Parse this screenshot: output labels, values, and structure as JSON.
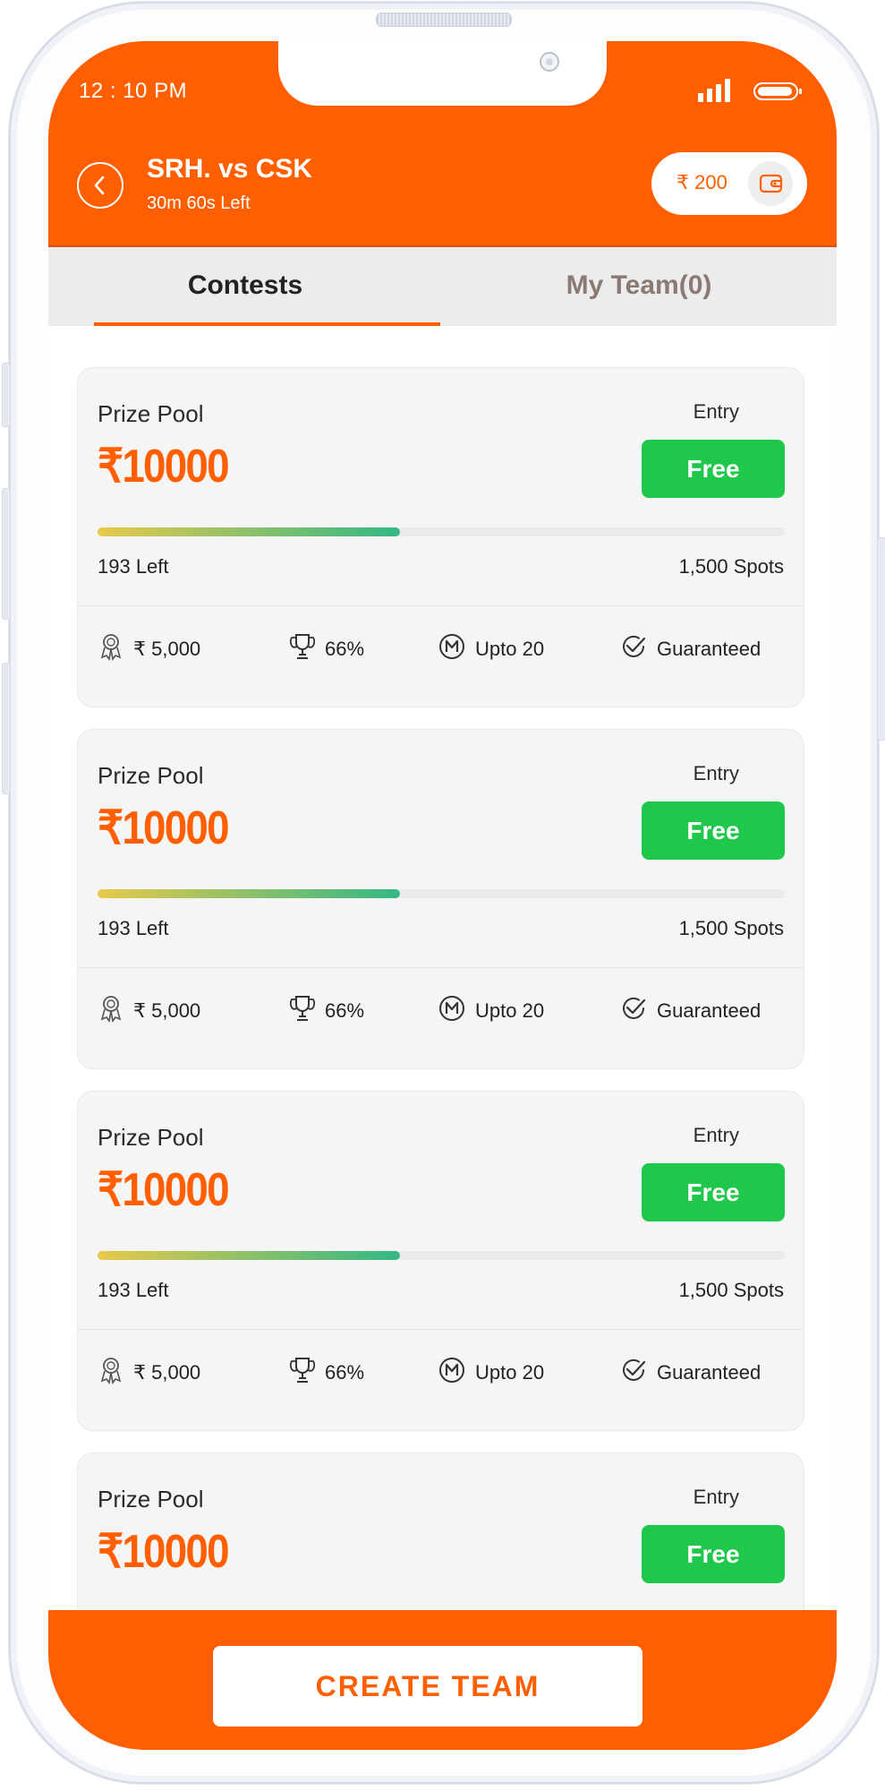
{
  "status_bar": {
    "time": "12 : 10 PM"
  },
  "header": {
    "title": "SRH. vs CSK",
    "time_left": "30m 60s Left",
    "wallet_amount": "₹ 200"
  },
  "tabs": [
    {
      "label": "Contests",
      "active": true
    },
    {
      "label": "My Team(0)",
      "active": false
    }
  ],
  "contests": [
    {
      "prize_label": "Prize Pool",
      "prize_amount": "₹10000",
      "entry_label": "Entry",
      "entry_value": "Free",
      "spots_left": "193 Left",
      "total_spots": "1,500 Spots",
      "fill_fraction": 0.44,
      "first_prize": "₹ 5,000",
      "win_percent": "66%",
      "max_entries": "Upto 20",
      "tag": "Guaranteed"
    },
    {
      "prize_label": "Prize Pool",
      "prize_amount": "₹10000",
      "entry_label": "Entry",
      "entry_value": "Free",
      "spots_left": "193 Left",
      "total_spots": "1,500 Spots",
      "fill_fraction": 0.44,
      "first_prize": "₹ 5,000",
      "win_percent": "66%",
      "max_entries": "Upto 20",
      "tag": "Guaranteed"
    },
    {
      "prize_label": "Prize Pool",
      "prize_amount": "₹10000",
      "entry_label": "Entry",
      "entry_value": "Free",
      "spots_left": "193 Left",
      "total_spots": "1,500 Spots",
      "fill_fraction": 0.44,
      "first_prize": "₹ 5,000",
      "win_percent": "66%",
      "max_entries": "Upto 20",
      "tag": "Guaranteed"
    },
    {
      "prize_label": "Prize Pool",
      "prize_amount": "₹10000",
      "entry_label": "Entry",
      "entry_value": "Free"
    }
  ],
  "footer": {
    "create_team_label": "CREATE  TEAM"
  },
  "colors": {
    "brand": "#ff5f00",
    "success": "#1fc84a",
    "card_bg": "#f5f5f5"
  },
  "icons": [
    "back-arrow-icon",
    "wallet-icon",
    "signal-icon",
    "battery-icon",
    "medal-icon",
    "trophy-icon",
    "m-circle-icon",
    "check-circle-icon"
  ]
}
